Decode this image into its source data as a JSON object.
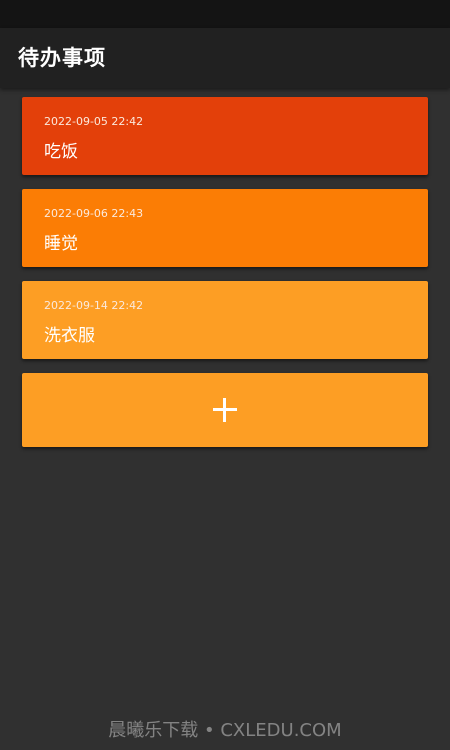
{
  "app": {
    "title": "待办事项"
  },
  "todos": [
    {
      "date": "2022-09-05 22:42",
      "text": "吃饭",
      "color": "#E3400A"
    },
    {
      "date": "2022-09-06 22:43",
      "text": "睡觉",
      "color": "#FB7D05"
    },
    {
      "date": "2022-09-14 22:42",
      "text": "洗衣服",
      "color": "#FD9E24"
    }
  ],
  "add_button": {
    "icon": "plus-icon",
    "color": "#FD9E24"
  },
  "watermark": {
    "text": "晨曦乐下载 • CXLEDU.COM"
  },
  "colors": {
    "background": "#303030",
    "app_bar": "#212121",
    "status_bar": "#141414"
  }
}
